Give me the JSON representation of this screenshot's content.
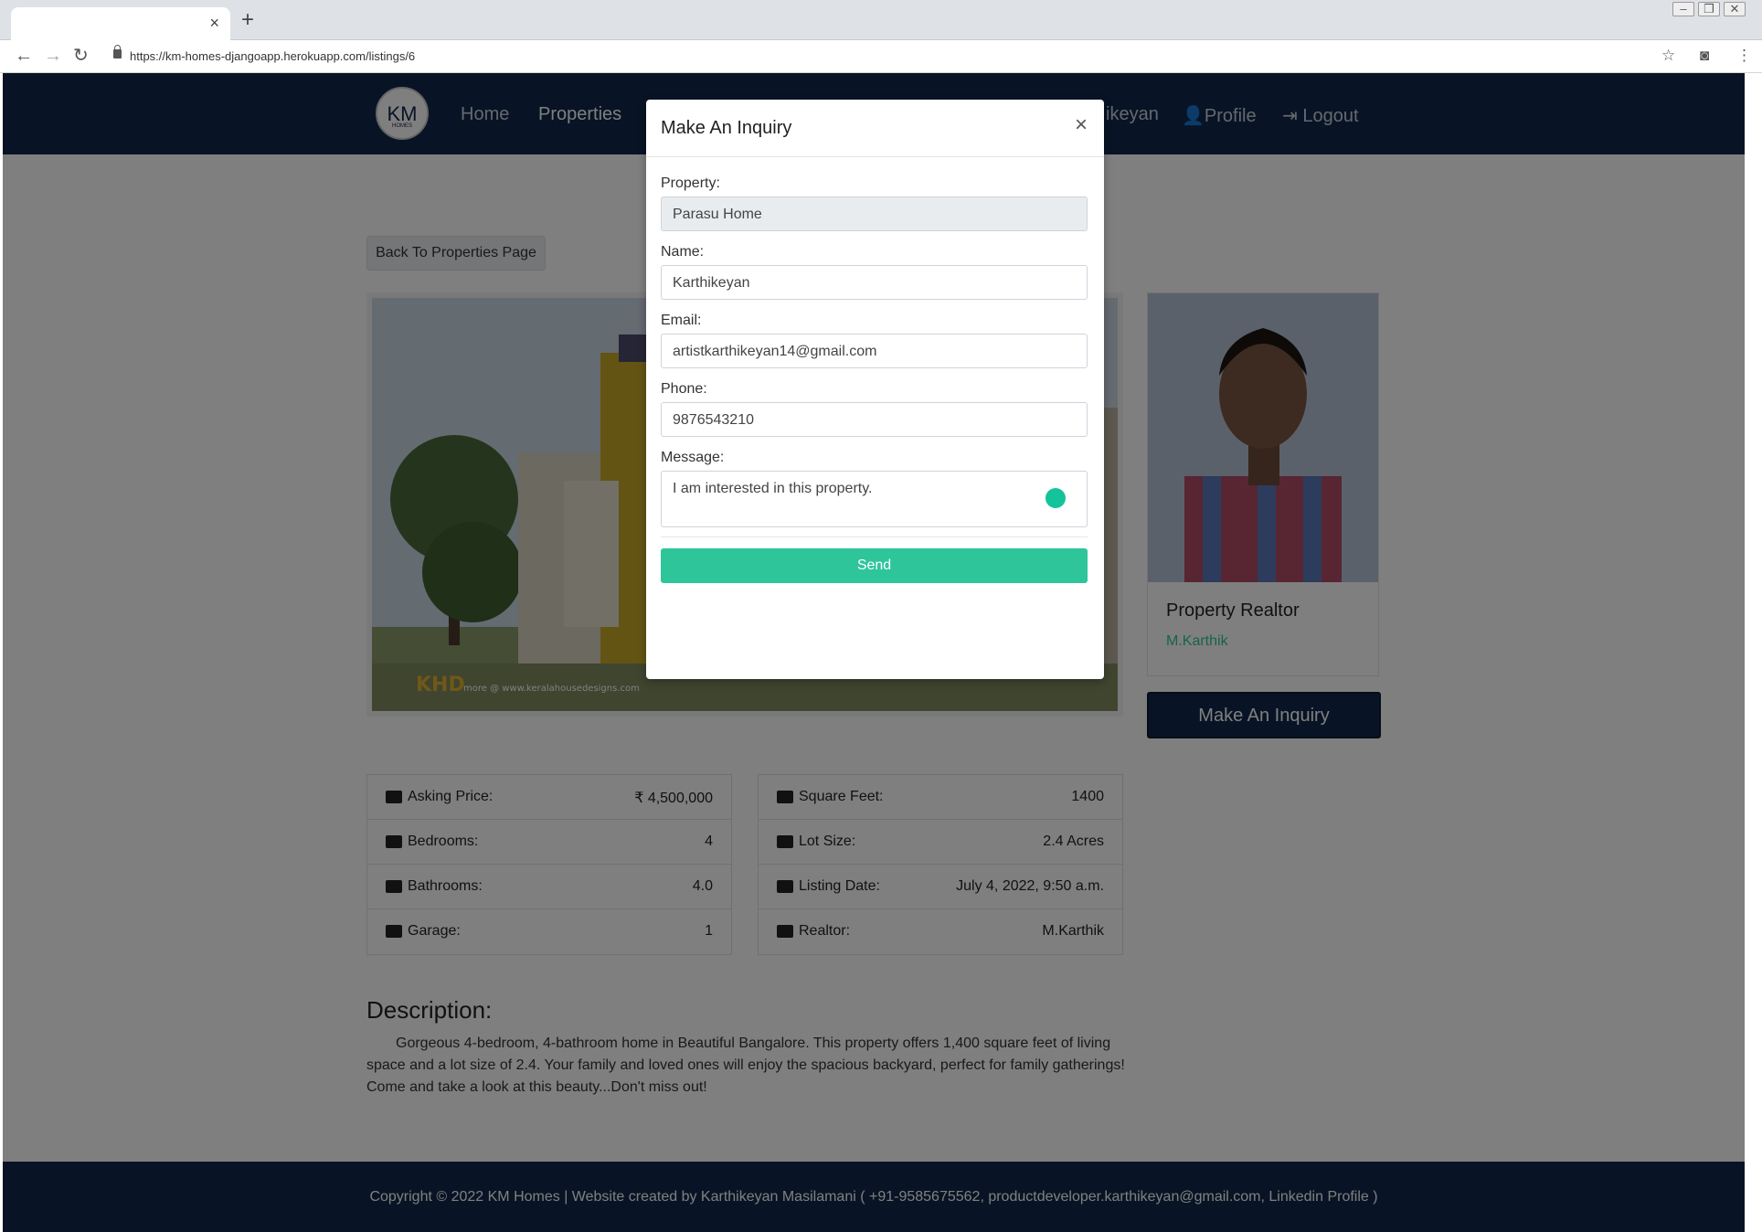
{
  "browser": {
    "url": "https://km-homes-djangoapp.herokuapp.com/listings/6",
    "tab_close": "×",
    "new_tab": "+"
  },
  "nav": {
    "logo_text": "KM",
    "logo_sub": "HOMES",
    "home": "Home",
    "properties": "Properties",
    "user": "ikeyan",
    "profile": "Profile",
    "logout": "Logout"
  },
  "listing": {
    "back_label": "Back To Properties Page",
    "realtor_title": "Property Realtor",
    "realtor_name": "M.Karthik",
    "inquiry_button": "Make An Inquiry",
    "left_details": [
      {
        "icon": "money-icon",
        "label": "Asking Price:",
        "value": "₹ 4,500,000"
      },
      {
        "icon": "bed-icon",
        "label": "Bedrooms:",
        "value": "4"
      },
      {
        "icon": "bath-icon",
        "label": "Bathrooms:",
        "value": "4.0"
      },
      {
        "icon": "car-icon",
        "label": "Garage:",
        "value": "1"
      }
    ],
    "right_details": [
      {
        "icon": "th-large-icon",
        "label": "Square Feet:",
        "value": "1400"
      },
      {
        "icon": "square-icon",
        "label": "Lot Size:",
        "value": "2.4 Acres"
      },
      {
        "icon": "calendar-icon",
        "label": "Listing Date:",
        "value": "July 4, 2022, 9:50 a.m."
      },
      {
        "icon": "bed-icon",
        "label": "Realtor:",
        "value": "M.Karthik"
      }
    ],
    "description_title": "Description:",
    "description": "Gorgeous 4-bedroom, 4-bathroom home in Beautiful Bangalore. This property offers 1,400 square feet of living space and a lot size of 2.4. Your family and loved ones will enjoy the spacious backyard, perfect for family gatherings! Come and take a look at this beauty...Don't miss out!",
    "image_logo": "KHD",
    "image_credit": "more @ www.keralahousedesigns.com"
  },
  "footer": {
    "text": "Copyright © 2022 KM Homes  |  Website created by Karthikeyan Masilamani (  +91-9585675562,  productdeveloper.karthikeyan@gmail.com,  Linkedin Profile )"
  },
  "modal": {
    "title": "Make An Inquiry",
    "close": "×",
    "property_label": "Property:",
    "property_value": "Parasu Home",
    "name_label": "Name:",
    "name_value": "Karthikeyan",
    "email_label": "Email:",
    "email_value": "artistkarthikeyan14@gmail.com",
    "phone_label": "Phone:",
    "phone_value": "9876543210",
    "message_label": "Message:",
    "message_value": "I am interested in this property.",
    "send_label": "Send"
  },
  "colors": {
    "navy": "#10284a",
    "accent": "#2ec59a"
  }
}
